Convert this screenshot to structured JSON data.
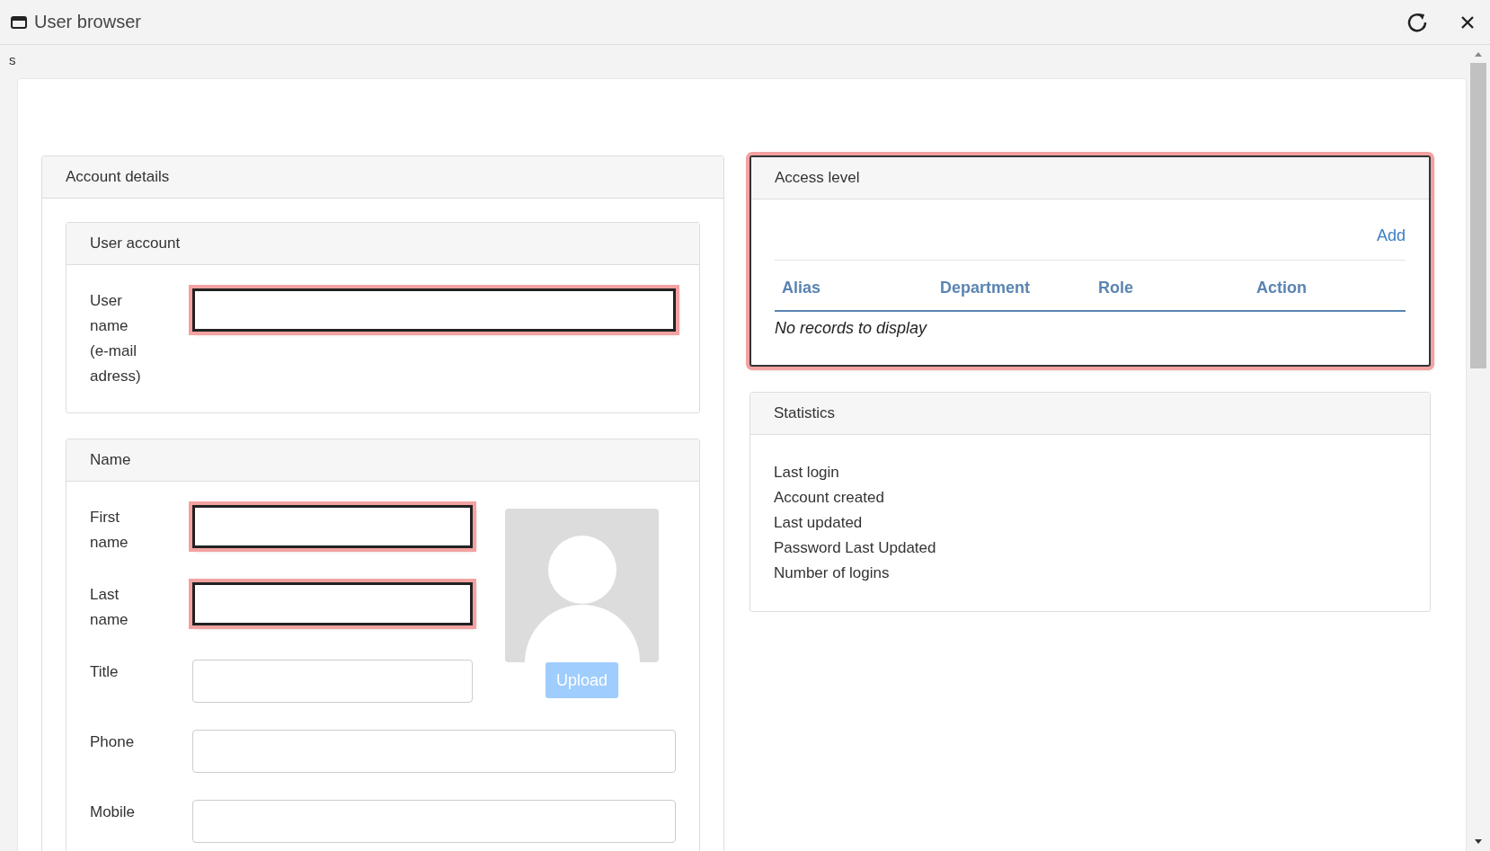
{
  "window": {
    "title": "User browser"
  },
  "breadcrumb": "s",
  "account_details": {
    "title": "Account details",
    "user_account": {
      "title": "User account",
      "fields": [
        {
          "label": "User name (e-mail adress)",
          "highlighted": true
        }
      ]
    },
    "name": {
      "title": "Name",
      "fields": [
        {
          "label": "First name",
          "highlighted": true,
          "kind": "short"
        },
        {
          "label": "Last name",
          "highlighted": true,
          "kind": "short"
        },
        {
          "label": "Title",
          "highlighted": false,
          "kind": "short"
        },
        {
          "label": "Phone",
          "highlighted": false,
          "kind": "wide"
        },
        {
          "label": "Mobile",
          "highlighted": false,
          "kind": "wide"
        }
      ],
      "upload_button": {
        "label": "Upload",
        "disabled": true
      }
    }
  },
  "access_level": {
    "title": "Access level",
    "highlighted": true,
    "add_link": "Add",
    "table": {
      "columns": [
        "Alias",
        "Department",
        "Role",
        "Action"
      ],
      "empty_message": "No records to display"
    }
  },
  "statistics": {
    "title": "Statistics",
    "items": [
      "Last login",
      "Account created",
      "Last updated",
      "Password Last Updated",
      "Number of logins"
    ]
  }
}
